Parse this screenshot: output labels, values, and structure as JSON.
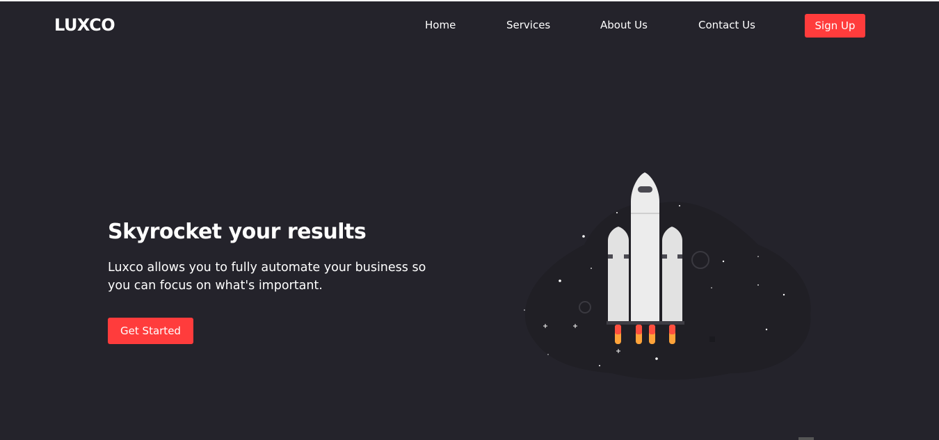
{
  "brand": {
    "logo": "LUXCO"
  },
  "nav": {
    "items": [
      {
        "label": "Home"
      },
      {
        "label": "Services"
      },
      {
        "label": "About Us"
      },
      {
        "label": "Contact Us"
      }
    ],
    "signup_label": "Sign Up"
  },
  "hero": {
    "title": "Skyrocket your results",
    "description": "Luxco allows you to fully automate your business so you can focus on what's important.",
    "cta_label": "Get Started",
    "illustration_icon": "rocket-launch-illustration"
  },
  "colors": {
    "background": "#24232b",
    "accent": "#ff3c3c",
    "text": "#ffffff"
  }
}
